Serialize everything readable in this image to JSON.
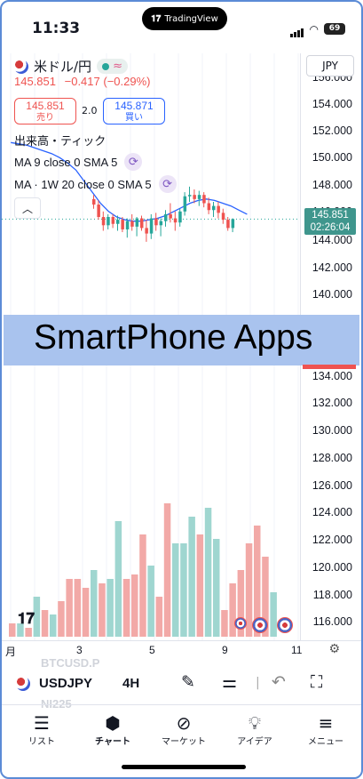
{
  "status_bar": {
    "time": "11:33",
    "island_text": "TradingView",
    "battery": "69"
  },
  "symbol": {
    "name": "米ドル/円",
    "price": "145.851",
    "change": "−0.417 (−0.29%)"
  },
  "trade": {
    "sell_price": "145.851",
    "sell_label": "売り",
    "spread": "2.0",
    "buy_price": "145.871",
    "buy_label": "買い"
  },
  "indicators": [
    {
      "label": "出来高・ティック"
    },
    {
      "label": "MA 9 close 0 SMA 5"
    },
    {
      "label": "MA · 1W 20 close 0 SMA 5"
    }
  ],
  "currency_selector": "JPY",
  "price_axis": [
    "156.000",
    "154.000",
    "152.000",
    "150.000",
    "148.000",
    "146.000",
    "144.000",
    "142.000",
    "140.000",
    "134.000",
    "132.000",
    "130.000",
    "128.000",
    "126.000",
    "124.000",
    "122.000",
    "120.000",
    "118.000",
    "116.000"
  ],
  "last_price": {
    "price": "145.851",
    "countdown": "02:26:04"
  },
  "banner": "SmartPhone Apps",
  "date_labels": [
    "月",
    "3",
    "5",
    "9",
    "11"
  ],
  "ghost_labels": [
    "BTCUSD.P",
    "NI225"
  ],
  "toolbar": {
    "symbol": "USDJPY",
    "interval": "4H"
  },
  "bottom_nav": [
    {
      "label": "リスト",
      "icon": "list-icon"
    },
    {
      "label": "チャート",
      "icon": "chart-icon"
    },
    {
      "label": "マーケット",
      "icon": "compass-icon"
    },
    {
      "label": "アイデア",
      "icon": "lightbulb-icon"
    },
    {
      "label": "メニュー",
      "icon": "menu-icon"
    }
  ],
  "colors": {
    "up": "#26a69a",
    "down": "#ef5350",
    "ma": "#2962ff",
    "banner": "#a9c3ee"
  },
  "chart_data": {
    "type": "candlestick",
    "candles": [
      {
        "o": 147.3,
        "h": 147.6,
        "l": 146.6,
        "c": 146.9
      },
      {
        "o": 146.9,
        "h": 147.2,
        "l": 145.8,
        "c": 146.0
      },
      {
        "o": 146.0,
        "h": 146.4,
        "l": 145.0,
        "c": 145.4
      },
      {
        "o": 145.4,
        "h": 146.2,
        "l": 145.1,
        "c": 146.0
      },
      {
        "o": 146.0,
        "h": 146.2,
        "l": 145.2,
        "c": 145.5
      },
      {
        "o": 145.5,
        "h": 146.1,
        "l": 145.0,
        "c": 145.8
      },
      {
        "o": 145.8,
        "h": 146.0,
        "l": 144.9,
        "c": 145.1
      },
      {
        "o": 145.1,
        "h": 145.9,
        "l": 144.5,
        "c": 145.7
      },
      {
        "o": 145.7,
        "h": 146.2,
        "l": 145.0,
        "c": 145.3
      },
      {
        "o": 145.3,
        "h": 146.0,
        "l": 144.6,
        "c": 145.9
      },
      {
        "o": 145.9,
        "h": 146.1,
        "l": 145.0,
        "c": 145.2
      },
      {
        "o": 145.2,
        "h": 145.8,
        "l": 144.2,
        "c": 144.8
      },
      {
        "o": 144.8,
        "h": 146.2,
        "l": 144.4,
        "c": 145.9
      },
      {
        "o": 145.9,
        "h": 146.3,
        "l": 145.0,
        "c": 145.4
      },
      {
        "o": 145.4,
        "h": 145.9,
        "l": 144.6,
        "c": 145.7
      },
      {
        "o": 145.7,
        "h": 146.5,
        "l": 145.3,
        "c": 146.2
      },
      {
        "o": 146.2,
        "h": 147.0,
        "l": 145.6,
        "c": 145.9
      },
      {
        "o": 145.9,
        "h": 146.4,
        "l": 145.0,
        "c": 145.6
      },
      {
        "o": 145.6,
        "h": 146.6,
        "l": 145.3,
        "c": 146.4
      },
      {
        "o": 146.4,
        "h": 147.8,
        "l": 146.1,
        "c": 147.5
      },
      {
        "o": 147.5,
        "h": 148.2,
        "l": 147.1,
        "c": 147.6
      },
      {
        "o": 147.6,
        "h": 148.0,
        "l": 147.0,
        "c": 147.3
      },
      {
        "o": 147.3,
        "h": 147.9,
        "l": 146.8,
        "c": 147.6
      },
      {
        "o": 147.6,
        "h": 147.8,
        "l": 146.7,
        "c": 147.0
      },
      {
        "o": 147.0,
        "h": 147.4,
        "l": 146.2,
        "c": 146.5
      },
      {
        "o": 146.5,
        "h": 147.1,
        "l": 146.0,
        "c": 146.8
      },
      {
        "o": 146.8,
        "h": 147.1,
        "l": 145.9,
        "c": 146.3
      },
      {
        "o": 146.3,
        "h": 146.6,
        "l": 145.5,
        "c": 145.8
      },
      {
        "o": 145.8,
        "h": 146.0,
        "l": 145.0,
        "c": 145.2
      },
      {
        "o": 145.2,
        "h": 145.9,
        "l": 144.9,
        "c": 145.85
      }
    ],
    "ma_line": [
      151.4,
      151.3,
      151.2,
      151.0,
      150.8,
      150.6,
      150.3,
      149.9,
      149.4,
      148.6,
      147.8,
      147.0,
      146.4,
      146.0,
      145.8,
      145.7,
      145.7,
      145.8,
      145.9,
      146.1,
      146.4,
      146.7,
      147.0,
      147.2,
      147.3,
      147.2,
      147.0,
      146.8,
      146.5,
      146.2
    ],
    "volume": [
      {
        "v": 3,
        "up": false
      },
      {
        "v": 3,
        "up": true
      },
      {
        "v": 2,
        "up": false
      },
      {
        "v": 9,
        "up": true
      },
      {
        "v": 6,
        "up": false
      },
      {
        "v": 5,
        "up": true
      },
      {
        "v": 8,
        "up": false
      },
      {
        "v": 13,
        "up": false
      },
      {
        "v": 13,
        "up": false
      },
      {
        "v": 11,
        "up": false
      },
      {
        "v": 15,
        "up": true
      },
      {
        "v": 12,
        "up": false
      },
      {
        "v": 13,
        "up": true
      },
      {
        "v": 26,
        "up": true
      },
      {
        "v": 13,
        "up": false
      },
      {
        "v": 14,
        "up": false
      },
      {
        "v": 23,
        "up": false
      },
      {
        "v": 16,
        "up": true
      },
      {
        "v": 9,
        "up": false
      },
      {
        "v": 30,
        "up": false
      },
      {
        "v": 21,
        "up": true
      },
      {
        "v": 21,
        "up": true
      },
      {
        "v": 27,
        "up": true
      },
      {
        "v": 23,
        "up": false
      },
      {
        "v": 29,
        "up": true
      },
      {
        "v": 22,
        "up": true
      },
      {
        "v": 6,
        "up": false
      },
      {
        "v": 12,
        "up": false
      },
      {
        "v": 15,
        "up": false
      },
      {
        "v": 21,
        "up": false
      },
      {
        "v": 25,
        "up": false
      },
      {
        "v": 18,
        "up": false
      },
      {
        "v": 10,
        "up": true
      }
    ]
  }
}
